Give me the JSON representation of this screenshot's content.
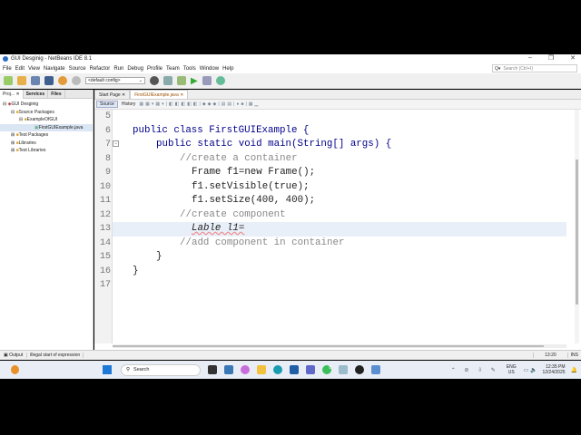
{
  "window": {
    "title": "GUI Desginig - NetBeans IDE 8.1",
    "minimize": "–",
    "restore": "❐",
    "close": "✕"
  },
  "menu": [
    "File",
    "Edit",
    "View",
    "Navigate",
    "Source",
    "Refactor",
    "Run",
    "Debug",
    "Profile",
    "Team",
    "Tools",
    "Window",
    "Help"
  ],
  "search": {
    "placeholder": "Search (Ctrl+I)"
  },
  "toolbar": {
    "config": "<default config>"
  },
  "left": {
    "tabs": [
      "Proj... ✕",
      "Services",
      "Files"
    ],
    "tree": [
      "GUI Desginig",
      "Source Packages",
      "ExampleOfGUI",
      "FirstGUIExample.java",
      "Test Packages",
      "Libraries",
      "Test Libraries"
    ]
  },
  "editor": {
    "tabs": [
      "Start Page ✕",
      "FirstGUIExample.java ✕"
    ],
    "source_label": "Source",
    "history_label": "History",
    "lines": [
      {
        "n": "5",
        "t": ""
      },
      {
        "n": "6",
        "t": "public class FirstGUIExample {"
      },
      {
        "n": "7",
        "t": "public static void main(String[] args) {"
      },
      {
        "n": "8",
        "t": "//create a container"
      },
      {
        "n": "9",
        "t": "Frame f1=new Frame();"
      },
      {
        "n": "10",
        "t": "f1.setVisible(true);"
      },
      {
        "n": "11",
        "t": "f1.setSize(400, 400);"
      },
      {
        "n": "12",
        "t": "//create component"
      },
      {
        "n": "13",
        "t": "Lable l1="
      },
      {
        "n": "14",
        "t": "//add component in container"
      },
      {
        "n": "15",
        "t": "}"
      },
      {
        "n": "16",
        "t": "}"
      },
      {
        "n": "17",
        "t": ""
      }
    ]
  },
  "status": {
    "output_tab": "Output",
    "message": "illegal start of expression",
    "position": "13:20",
    "mode": "INS"
  },
  "taskbar": {
    "search": "Search",
    "lang": "ENG",
    "region": "US",
    "time": "12:35 PM",
    "date": "12/24/2025",
    "badge": "8"
  }
}
